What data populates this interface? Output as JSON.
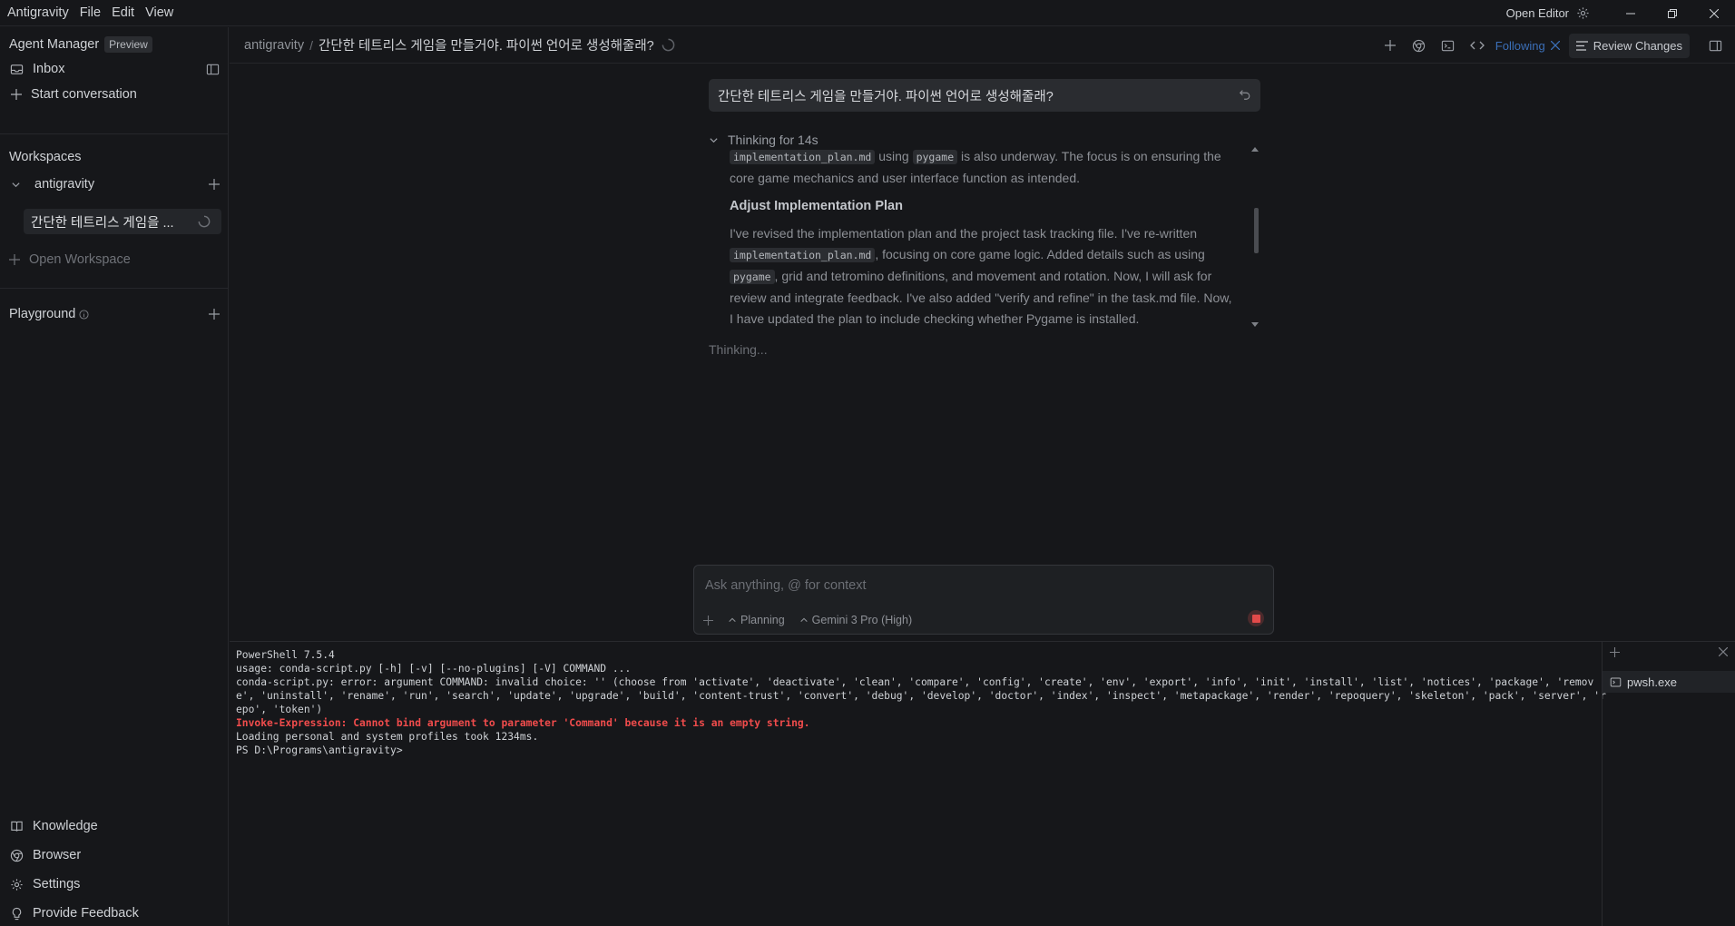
{
  "titlebar": {
    "menu": [
      "Antigravity",
      "File",
      "Edit",
      "View"
    ],
    "open_editor": "Open Editor"
  },
  "sidebar": {
    "agent_manager": "Agent Manager",
    "preview_badge": "Preview",
    "inbox": "Inbox",
    "start_conversation": "Start conversation",
    "workspaces_heading": "Workspaces",
    "workspace_name": "antigravity",
    "current_conversation": "간단한 테트리스 게임을 ...",
    "open_workspace": "Open Workspace",
    "playground": "Playground",
    "bottom": {
      "knowledge": "Knowledge",
      "browser": "Browser",
      "settings": "Settings",
      "feedback": "Provide Feedback"
    }
  },
  "header": {
    "breadcrumb_root": "antigravity",
    "breadcrumb_sep": "/",
    "conversation_title": "간단한 테트리스 게임을 만들거야. 파이썬 언어로 생성해줄래?",
    "following": "Following",
    "review_changes": "Review Changes"
  },
  "chat": {
    "user_message": "간단한 테트리스 게임을 만들거야. 파이썬 언어로 생성해줄래?",
    "thinking_label": "Thinking for 14s",
    "thought_1": {
      "code_a": "implementation_plan.md",
      "text_a": " using ",
      "code_b": "pygame",
      "text_b": " is also underway. The focus is on ensuring the core game mechanics and user interface function as intended."
    },
    "thought_2": {
      "heading": "Adjust Implementation Plan",
      "text_a": "I've revised the implementation plan and the project task tracking file. I've re-written ",
      "code_a": "implementation_plan.md",
      "text_b": ", focusing on core game logic. Added details such as using ",
      "code_b": "pygame",
      "text_c": ", grid and tetromino definitions, and movement and rotation. Now, I will ask for review and integrate feedback. I've also added \"verify and refine\" in the task.md file. Now, I have updated the plan to include checking whether Pygame is installed."
    },
    "status": "Thinking..."
  },
  "input": {
    "placeholder": "Ask anything, @ for context",
    "mode": "Planning",
    "model": "Gemini 3 Pro (High)"
  },
  "terminal": {
    "lines": [
      "PowerShell 7.5.4",
      "usage: conda-script.py [-h] [-v] [--no-plugins] [-V] COMMAND ...",
      "conda-script.py: error: argument COMMAND: invalid choice: '' (choose from 'activate', 'deactivate', 'clean', 'compare', 'config', 'create', 'env', 'export', 'info', 'init', 'install', 'list', 'notices', 'package', 'remove', 'uninstall', 'rename', 'run', 'search', 'update', 'upgrade', 'build', 'content-trust', 'convert', 'debug', 'develop', 'doctor', 'index', 'inspect', 'metapackage', 'render', 'repoquery', 'skeleton', 'pack', 'server', 'repo', 'token')"
    ],
    "error_line": "Invoke-Expression: Cannot bind argument to parameter 'Command' because it is an empty string.",
    "loading_line": "Loading personal and system profiles took 1234ms.",
    "prompt": "PS D:\\Programs\\antigravity>",
    "process": "pwsh.exe"
  },
  "colors": {
    "accent_following": "#3b6fb8",
    "error_red": "#f14c4c",
    "stop_red": "#e24a4a"
  }
}
